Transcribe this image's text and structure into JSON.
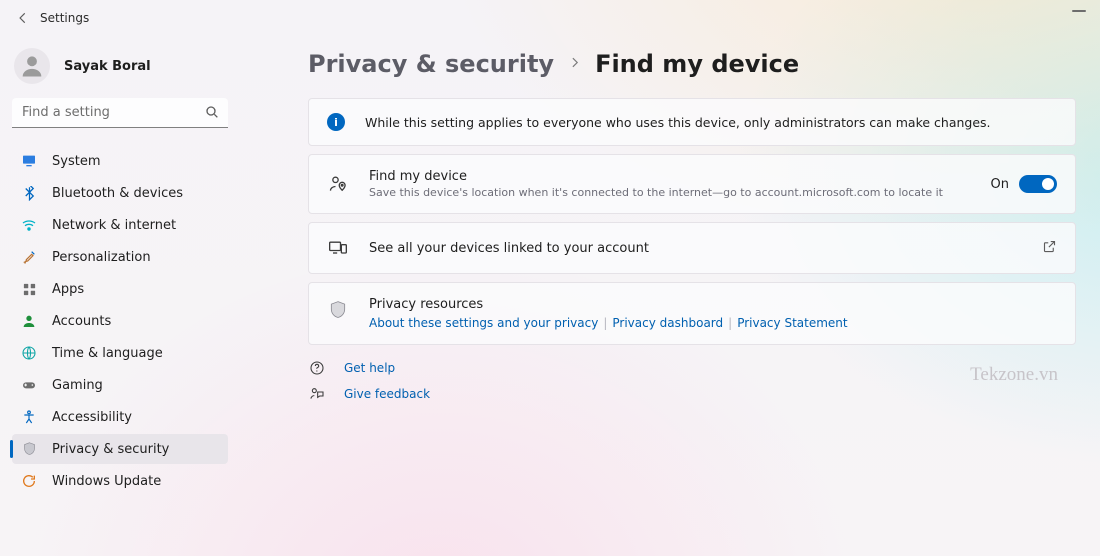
{
  "title": "Settings",
  "user": {
    "name": "Sayak Boral"
  },
  "search": {
    "placeholder": "Find a setting"
  },
  "sidebar": {
    "items": [
      {
        "label": "System",
        "icon": "system"
      },
      {
        "label": "Bluetooth & devices",
        "icon": "bluetooth"
      },
      {
        "label": "Network & internet",
        "icon": "wifi"
      },
      {
        "label": "Personalization",
        "icon": "brush"
      },
      {
        "label": "Apps",
        "icon": "apps"
      },
      {
        "label": "Accounts",
        "icon": "account"
      },
      {
        "label": "Time & language",
        "icon": "globe"
      },
      {
        "label": "Gaming",
        "icon": "gaming"
      },
      {
        "label": "Accessibility",
        "icon": "accessibility"
      },
      {
        "label": "Privacy & security",
        "icon": "shield"
      },
      {
        "label": "Windows Update",
        "icon": "update"
      }
    ],
    "active_index": 9
  },
  "breadcrumb": {
    "a": "Privacy & security",
    "b": "Find my device"
  },
  "banner": {
    "text": "While this setting applies to everyone who uses this device, only administrators can make changes."
  },
  "find_my_device": {
    "title": "Find my device",
    "desc": "Save this device's location when it's connected to the internet—go to account.microsoft.com to locate it",
    "state_label": "On",
    "state": true
  },
  "see_all": {
    "text": "See all your devices linked to your account"
  },
  "resources": {
    "title": "Privacy resources",
    "links": [
      "About these settings and your privacy",
      "Privacy dashboard",
      "Privacy Statement"
    ]
  },
  "actions": {
    "help": "Get help",
    "feedback": "Give feedback"
  },
  "watermark": "Tekzone.vn"
}
